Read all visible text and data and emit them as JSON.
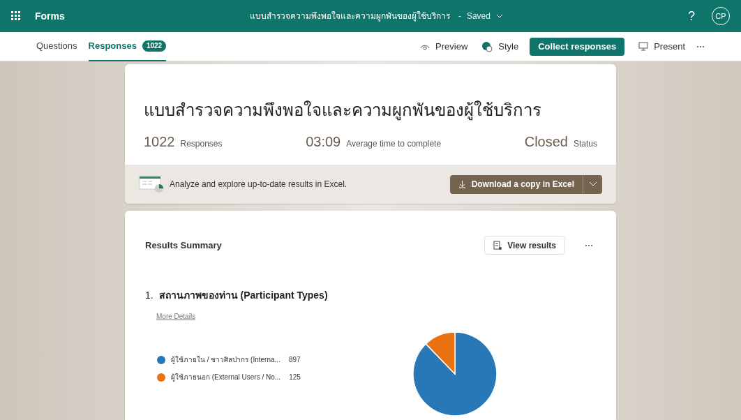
{
  "app": {
    "name": "Forms",
    "form_title": "แบบสำรวจความพึงพอใจและความผูกพันของผู้ใช้บริการ",
    "separator": "-",
    "save_state": "Saved",
    "help": "?",
    "avatar": "CP"
  },
  "tabs": [
    {
      "label": "Questions",
      "selected": false
    },
    {
      "label": "Responses",
      "selected": true,
      "count": "1022"
    }
  ],
  "toolbar": {
    "preview": "Preview",
    "style": "Style",
    "collect": "Collect responses",
    "present": "Present"
  },
  "summary": {
    "title": "แบบสำรวจความพึงพอใจและความผูกพันของผู้ใช้บริการ",
    "stats": [
      {
        "value": "1022",
        "label": "Responses"
      },
      {
        "value": "03:09",
        "label": "Average time to complete"
      },
      {
        "value": "Closed",
        "label": "Status"
      }
    ],
    "excel_text": "Analyze and explore up-to-date results in Excel.",
    "download": "Download a copy in Excel"
  },
  "results": {
    "title": "Results Summary",
    "view_results": "View results",
    "questions": [
      {
        "number": "1.",
        "title": "สถานภาพของท่าน (Participant Types)",
        "details": "More Details",
        "chart_data": {
          "type": "pie",
          "categories": [
            "ผู้ใช้ภายใน / ชาวศิลปากร (Interna...",
            "ผู้ใช้ภายนอก (External Users / No..."
          ],
          "series": [
            {
              "colors": [
                "#2878b8",
                "#ea7110"
              ],
              "values": [
                87.77,
                12.23
              ]
            }
          ]
        },
        "legend_counts": [
          "897",
          "125"
        ]
      }
    ]
  }
}
